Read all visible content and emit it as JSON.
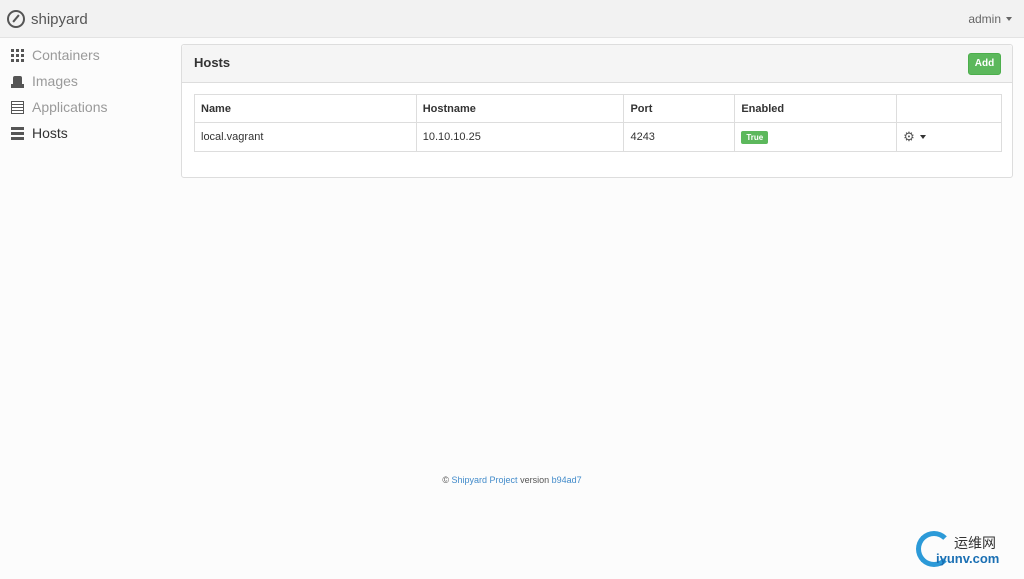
{
  "navbar": {
    "brand": "shipyard",
    "user": "admin"
  },
  "sidebar": {
    "items": [
      {
        "label": "Containers",
        "icon": "grid-icon"
      },
      {
        "label": "Images",
        "icon": "drive-icon"
      },
      {
        "label": "Applications",
        "icon": "list-icon"
      },
      {
        "label": "Hosts",
        "icon": "server-icon",
        "active": true
      }
    ]
  },
  "panel": {
    "title": "Hosts",
    "add_label": "Add",
    "table": {
      "columns": [
        "Name",
        "Hostname",
        "Port",
        "Enabled",
        ""
      ],
      "rows": [
        {
          "name": "local.vagrant",
          "hostname": "10.10.10.25",
          "port": "4243",
          "enabled": "True"
        }
      ]
    }
  },
  "footer": {
    "copyright": "©",
    "project": "Shipyard Project",
    "version_label": "version",
    "version": "b94ad7"
  },
  "watermark": {
    "cn": "运维网",
    "en": "iyunv.com"
  },
  "colors": {
    "accent": "#5cb85c",
    "link": "#428bca"
  }
}
